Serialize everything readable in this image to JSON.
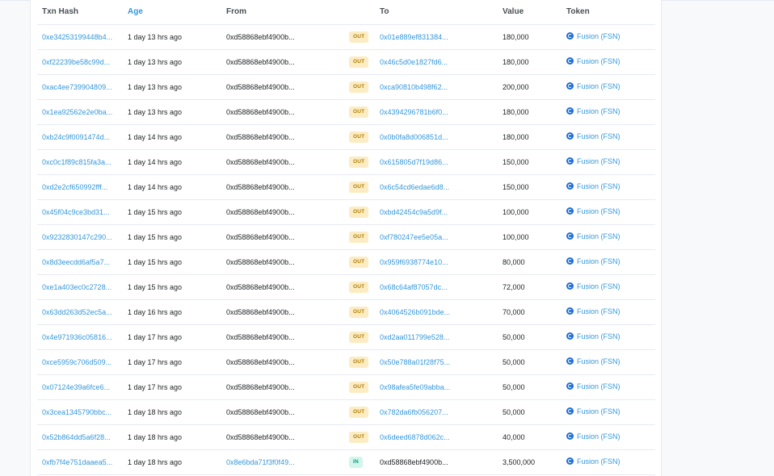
{
  "table": {
    "headers": {
      "hash": "Txn Hash",
      "age": "Age",
      "from": "From",
      "to": "To",
      "value": "Value",
      "token": "Token"
    },
    "rows": [
      {
        "hash": "0xe34253199448b4...",
        "age": "1 day 13 hrs ago",
        "from": "0xd58868ebf4900b...",
        "dir": "OUT",
        "to": "0x01e889ef831384...",
        "value": "180,000",
        "token": "Fusion (FSN)"
      },
      {
        "hash": "0xf22239be58c99d...",
        "age": "1 day 13 hrs ago",
        "from": "0xd58868ebf4900b...",
        "dir": "OUT",
        "to": "0x46c5d0e1827fd6...",
        "value": "180,000",
        "token": "Fusion (FSN)"
      },
      {
        "hash": "0xac4ee739904809...",
        "age": "1 day 13 hrs ago",
        "from": "0xd58868ebf4900b...",
        "dir": "OUT",
        "to": "0xca90810b498f62...",
        "value": "200,000",
        "token": "Fusion (FSN)"
      },
      {
        "hash": "0x1ea92562e2e0ba...",
        "age": "1 day 13 hrs ago",
        "from": "0xd58868ebf4900b...",
        "dir": "OUT",
        "to": "0x4394296781b6f0...",
        "value": "180,000",
        "token": "Fusion (FSN)"
      },
      {
        "hash": "0xb24c9f0091474d...",
        "age": "1 day 14 hrs ago",
        "from": "0xd58868ebf4900b...",
        "dir": "OUT",
        "to": "0x0b0fa8d006851d...",
        "value": "180,000",
        "token": "Fusion (FSN)"
      },
      {
        "hash": "0xc0c1f89c815fa3a...",
        "age": "1 day 14 hrs ago",
        "from": "0xd58868ebf4900b...",
        "dir": "OUT",
        "to": "0x615805d7f19d86...",
        "value": "150,000",
        "token": "Fusion (FSN)"
      },
      {
        "hash": "0xd2e2cf650992fff...",
        "age": "1 day 14 hrs ago",
        "from": "0xd58868ebf4900b...",
        "dir": "OUT",
        "to": "0x6c54cd6edae6d8...",
        "value": "150,000",
        "token": "Fusion (FSN)"
      },
      {
        "hash": "0x45f04c9ce3bd31...",
        "age": "1 day 15 hrs ago",
        "from": "0xd58868ebf4900b...",
        "dir": "OUT",
        "to": "0xbd42454c9a5d9f...",
        "value": "100,000",
        "token": "Fusion (FSN)"
      },
      {
        "hash": "0x9232830147c290...",
        "age": "1 day 15 hrs ago",
        "from": "0xd58868ebf4900b...",
        "dir": "OUT",
        "to": "0xf780247ee5e05a...",
        "value": "100,000",
        "token": "Fusion (FSN)"
      },
      {
        "hash": "0x8d3eecdd6af5a7...",
        "age": "1 day 15 hrs ago",
        "from": "0xd58868ebf4900b...",
        "dir": "OUT",
        "to": "0x959f6938774e10...",
        "value": "80,000",
        "token": "Fusion (FSN)"
      },
      {
        "hash": "0xe1a403ec0c2728...",
        "age": "1 day 15 hrs ago",
        "from": "0xd58868ebf4900b...",
        "dir": "OUT",
        "to": "0x68c64af87057dc...",
        "value": "72,000",
        "token": "Fusion (FSN)"
      },
      {
        "hash": "0x63dd263d52ec5a...",
        "age": "1 day 16 hrs ago",
        "from": "0xd58868ebf4900b...",
        "dir": "OUT",
        "to": "0x4064526b091bde...",
        "value": "70,000",
        "token": "Fusion (FSN)"
      },
      {
        "hash": "0x4e971936c05816...",
        "age": "1 day 17 hrs ago",
        "from": "0xd58868ebf4900b...",
        "dir": "OUT",
        "to": "0xd2aa011799e528...",
        "value": "50,000",
        "token": "Fusion (FSN)"
      },
      {
        "hash": "0xce5959c706d509...",
        "age": "1 day 17 hrs ago",
        "from": "0xd58868ebf4900b...",
        "dir": "OUT",
        "to": "0x50e788a01f28f75...",
        "value": "50,000",
        "token": "Fusion (FSN)"
      },
      {
        "hash": "0x07124e39a6fce6...",
        "age": "1 day 17 hrs ago",
        "from": "0xd58868ebf4900b...",
        "dir": "OUT",
        "to": "0x98afea5fe09abba...",
        "value": "50,000",
        "token": "Fusion (FSN)"
      },
      {
        "hash": "0x3cea1345790bbc...",
        "age": "1 day 18 hrs ago",
        "from": "0xd58868ebf4900b...",
        "dir": "OUT",
        "to": "0x782da6fb056207...",
        "value": "50,000",
        "token": "Fusion (FSN)"
      },
      {
        "hash": "0x52b864dd5a6f28...",
        "age": "1 day 18 hrs ago",
        "from": "0xd58868ebf4900b...",
        "dir": "OUT",
        "to": "0x6deed6878d062c...",
        "value": "40,000",
        "token": "Fusion (FSN)"
      },
      {
        "hash": "0xfb7f4e751daaea5...",
        "age": "1 day 18 hrs ago",
        "from": "0x8e6bda71f3f0f49...",
        "dir": "IN",
        "to": "0xd58868ebf4900b...",
        "value": "3,500,000",
        "token": "Fusion (FSN)"
      }
    ]
  },
  "token_icon": "fusion-token-icon",
  "colors": {
    "link": "#3498db",
    "out_badge_bg": "#fbecc4",
    "out_badge_text": "#b47d00",
    "in_badge_bg": "#d4f5e9",
    "in_badge_text": "#00a186"
  }
}
